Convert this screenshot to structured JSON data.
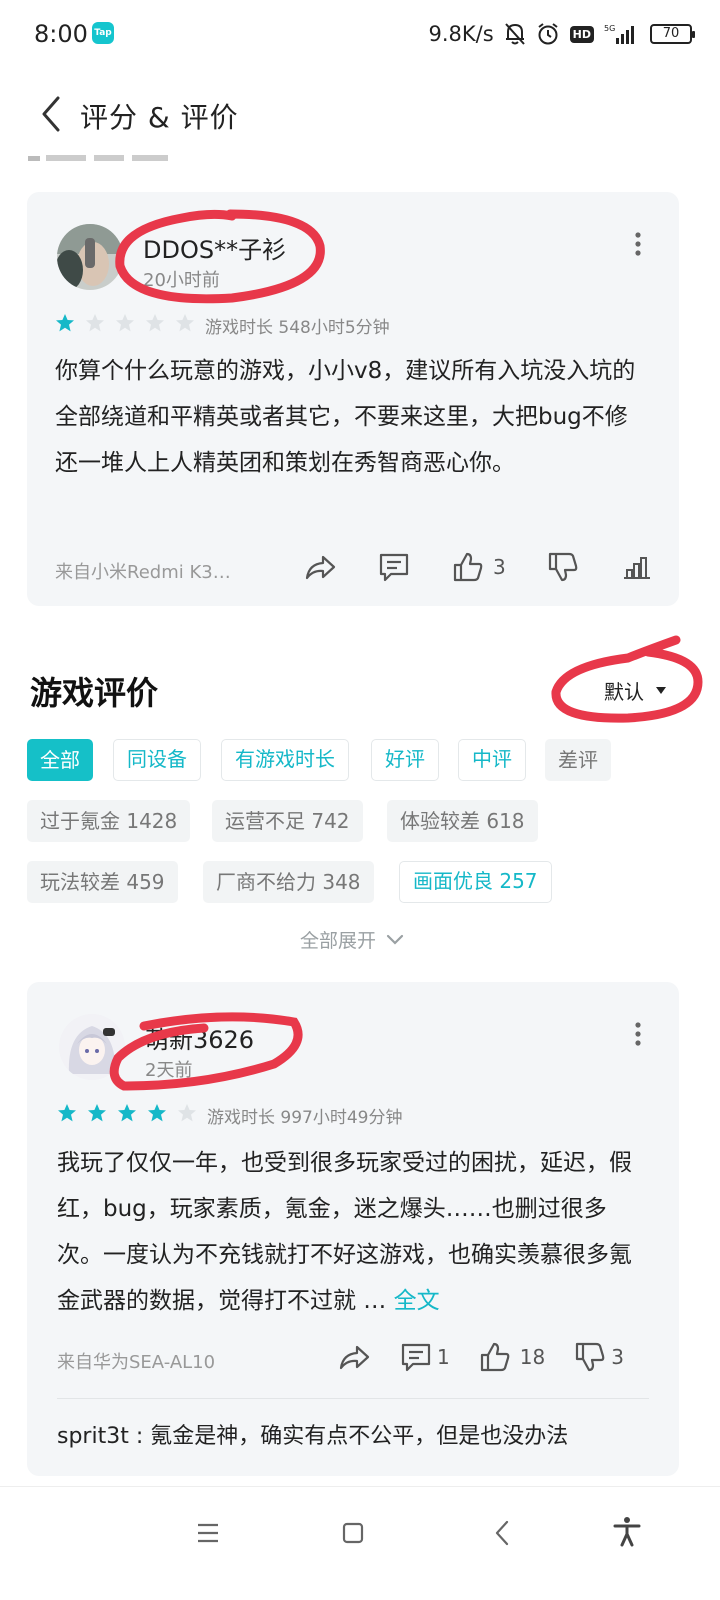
{
  "status_bar": {
    "time": "8:00",
    "app_badge": "Tap",
    "net_speed": "9.8K/s",
    "battery": "70"
  },
  "header": {
    "title": "评分 & 评价"
  },
  "featured_review": {
    "username": "DDOS**子衫",
    "time": "20小时前",
    "rating": 1,
    "play_time": "游戏时长 548小时5分钟",
    "text": "你算个什么玩意的游戏，小小v8，建议所有入坑没入坑的全部绕道和平精英或者其它，不要来这里，大把bug不修还一堆人上人精英团和策划在秀智商恶心你。",
    "device": "来自小米Redmi K3…",
    "likes": "3"
  },
  "reviews_section": {
    "title": "游戏评价",
    "sort_label": "默认",
    "expand_label": "全部展开"
  },
  "filters": {
    "row1": [
      "全部",
      "同设备",
      "有游戏时长",
      "好评",
      "中评",
      "差评"
    ],
    "row2": [
      "过于氪金 1428",
      "运营不足 742",
      "体验较差 618"
    ],
    "row3": [
      "玩法较差 459",
      "厂商不给力 348",
      "画面优良 257"
    ]
  },
  "review_2": {
    "username": "萌新3626",
    "time": "2天前",
    "rating": 4,
    "play_time": "游戏时长 997小时49分钟",
    "text": "我玩了仅仅一年，也受到很多玩家受过的困扰，延迟，假红，bug，玩家素质，氪金，迷之爆头……也删过很多次。一度认为不充钱就打不好这游戏，也确实羡慕很多氪金武器的数据，觉得打不过就 …",
    "full_text_link": "全文",
    "device": "来自华为SEA-AL10",
    "comments": "1",
    "likes": "18",
    "dislikes": "3",
    "reply_user": "sprit3t",
    "reply_text": "氪金是神，确实有点不公平，但是也没办法"
  },
  "colors": {
    "accent": "#15c0c8",
    "star_filled": "#15b8c8",
    "star_empty": "#dfe3e6",
    "card_bg": "#f4f6f8",
    "scribble": "#e8384a"
  }
}
